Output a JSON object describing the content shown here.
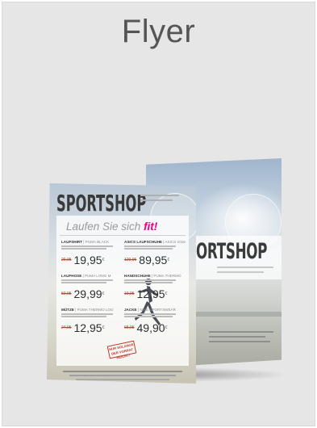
{
  "title": "Flyer",
  "front": {
    "brand": "SPORTSHOP",
    "headline": "Laufen Sie sich ",
    "headline_highlight": "fit!",
    "items": [
      {
        "name": "LAUFSHIRT",
        "detail": " | PUMA BLACK",
        "old_price": "29,95",
        "price": "19,95"
      },
      {
        "name": "ASICS LAUFSCHUHE",
        "detail": " | ASICS 2016",
        "old_price": "129,95",
        "price": "89,95"
      },
      {
        "name": "LAUFHOSE",
        "detail": " | PUMA LONG M",
        "old_price": "59,95",
        "price": "29,99"
      },
      {
        "name": "HANDSCHUHE",
        "detail": " | PUMA THERMO",
        "old_price": "19,95",
        "price": "12,95"
      },
      {
        "name": "MÜTZE",
        "detail": " | PUMA THERMO LOG",
        "old_price": "24,95",
        "price": "12,95"
      },
      {
        "name": "JACKE",
        "detail": " | NIKE SPORTSWEAR",
        "old_price": "65,95",
        "price": "49,90"
      }
    ],
    "currency": "€",
    "stamp": "NUR SOLANGE DER VORRAT REICHT!"
  },
  "back": {
    "brand": "PORTSHOP"
  },
  "colors": {
    "accent": "#e4007f",
    "stamp": "#c0392b",
    "card_bg": "#e6e6e6",
    "title": "#555555"
  }
}
